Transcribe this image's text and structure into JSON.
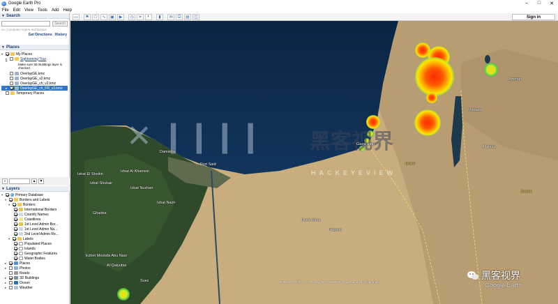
{
  "app": {
    "title": "Google Earth Pro"
  },
  "menu": [
    "File",
    "Edit",
    "View",
    "Tools",
    "Add",
    "Help"
  ],
  "toolbar": {
    "signin_label": "Sign in"
  },
  "search": {
    "header": "Search",
    "button": "Search",
    "placeholder": "ex: Computer Hypee mal Boston",
    "get_directions": "Get Directions",
    "history": "History"
  },
  "places": {
    "header": "Places",
    "items": [
      {
        "label": "My Places"
      },
      {
        "label": "Sightseeing Tour"
      },
      {
        "label": "Make sure 3D Buildings layer is checked"
      },
      {
        "label": "OverlayGE.kmz"
      },
      {
        "label": "OverlayGE_v2.kmz"
      },
      {
        "label": "OverlayGE_ch_v2.kmz"
      },
      {
        "label": "OverlayGE_ch_FR_v3.kmz"
      },
      {
        "label": "Temporary Places"
      }
    ]
  },
  "layers": {
    "header": "Layers",
    "items": [
      {
        "label": "Primary Database"
      },
      {
        "label": "Borders and Labels"
      },
      {
        "label": "Borders"
      },
      {
        "label": "International Borders"
      },
      {
        "label": "Country Names"
      },
      {
        "label": "Coastlines"
      },
      {
        "label": "1st Level Admin Bor..."
      },
      {
        "label": "1st Level Admin Na..."
      },
      {
        "label": "2nd Level Admin Re..."
      },
      {
        "label": "Labels"
      },
      {
        "label": "Populated Places"
      },
      {
        "label": "Islands"
      },
      {
        "label": "Geographic Features"
      },
      {
        "label": "Water Bodies"
      },
      {
        "label": "Places"
      },
      {
        "label": "Photos"
      },
      {
        "label": "Roads"
      },
      {
        "label": "3D Buildings"
      },
      {
        "label": "Ocean"
      },
      {
        "label": "Weather"
      }
    ]
  },
  "map": {
    "labels": {
      "damietta": "Damietta",
      "port_said": "Port Said",
      "izbat_el_sheikh": "Izbat El Sheikh",
      "izbat_al_khamsin": "Izbat Al Khamsin",
      "izbat_shukair": "Izbat Shukair",
      "izbat_nuzhan": "Izbat Nuzhan",
      "izbat_nazir": "Izbat Nazir",
      "north_sinai": "North Sinai",
      "hasana": "Hasana",
      "amman": "Amman",
      "madaba": "Madaba",
      "al_hasa": "Al Hasa",
      "israel": "Israel",
      "jordan": "Jordan",
      "ezbet_mostafa": "Ezbet Mostafa Abu Nasr",
      "al_qalyubia": "Al Qalyubia",
      "suez": "Suez",
      "gaza": "Gaza Strip",
      "charbia": "Gharbia"
    },
    "watermark_brand": "黑客视界",
    "watermark_sub": "HACKEYEVIEW",
    "wechat_label": "黑客视界",
    "google_earth": "Google Earth",
    "attribution": "Data SIO, NOAA, U.S. Navy, NGA, GEBCO  Image Landsat / Copernicus"
  },
  "colors": {
    "accent": "#3275c8",
    "sea": "#0c2a4a",
    "nile": "#2f4a2a",
    "desert": "#c7a97a"
  }
}
